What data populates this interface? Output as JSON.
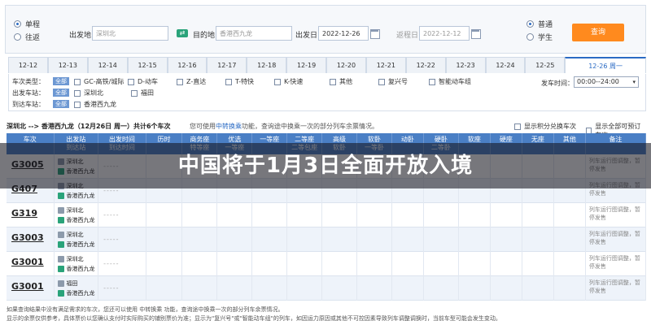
{
  "search": {
    "trip_types": [
      "单程",
      "往返"
    ],
    "from_label": "出发地",
    "from_value": "深圳北",
    "to_label": "目的地",
    "to_value": "香港西九龙",
    "depart_label": "出发日",
    "depart_value": "2022-12-26",
    "return_label": "返程日",
    "return_value": "2022-12-12",
    "passenger_types": [
      "普通",
      "学生"
    ],
    "query_button": "查询"
  },
  "date_tabs": [
    "12-12",
    "12-13",
    "12-14",
    "12-15",
    "12-16",
    "12-17",
    "12-18",
    "12-19",
    "12-20",
    "12-21",
    "12-22",
    "12-23",
    "12-24",
    "12-25",
    "12-26 周一"
  ],
  "filters": {
    "train_type_label": "车次类型：",
    "from_station_label": "出发车站：",
    "to_station_label": "到达车站：",
    "all_tag": "全部",
    "train_types": [
      "GC-高铁/城际",
      "D-动车",
      "Z-直达",
      "T-特快",
      "K-快速",
      "其他",
      "复兴号",
      "智能动车组"
    ],
    "from_stations": [
      "深圳北"
    ],
    "to_stations": [
      "香港西九龙",
      "福田"
    ],
    "depart_time_label": "发车时间：",
    "depart_time_value": "00:00--24:00"
  },
  "summary": {
    "route": "深圳北 --> 香港西九龙（12月26日 周一）共计6个车次",
    "hint_prefix": "您可使用",
    "hint_link": "中转换乘",
    "hint_suffix": "功能，查询途中换乘一次的部分列车余票情况。",
    "opt_points": "显示积分兑换车次",
    "opt_all": "显示全部可预订车次"
  },
  "table": {
    "headers": [
      "车次",
      "出发站\n到达站",
      "出发时间\n到达时间",
      "历时",
      "商务座\n特等座",
      "优选\n一等座",
      "一等座",
      "二等座\n二等包座",
      "高级\n软卧",
      "软卧\n一等卧",
      "动卧",
      "硬卧\n二等卧",
      "软座",
      "硬座",
      "无座",
      "其他",
      "备注"
    ],
    "rows": [
      {
        "train": "G3005",
        "from": "深圳北",
        "to": "香港西九龙",
        "remark": "列车运行图调整，暂停发售"
      },
      {
        "train": "G407",
        "from": "深圳北",
        "to": "香港西九龙",
        "remark": "列车运行图调整，暂停发售"
      },
      {
        "train": "G319",
        "from": "深圳北",
        "to": "香港西九龙",
        "remark": "列车运行图调整，暂停发售"
      },
      {
        "train": "G3003",
        "from": "深圳北",
        "to": "香港西九龙",
        "remark": "列车运行图调整，暂停发售"
      },
      {
        "train": "G3001",
        "from": "深圳北",
        "to": "香港西九龙",
        "remark": "列车运行图调整，暂停发售"
      },
      {
        "train": "G3001",
        "from": "福田",
        "to": "香港西九龙",
        "remark": "列车运行图调整，暂停发售"
      }
    ],
    "empty_cell": "-----"
  },
  "notes": [
    "如果查询结果中没有满足需求的车次，您还可以使用 中转换乘 功能，查询途中换乘一次的部分列车余票情况。",
    "显示的余票仅供参考，具体票价以您确认支付时实际购买的铺别票价为准；显示为\"复兴号\"或\"智能动车组\"的列车，如因运力原因或其他不可控因素导致列车调整调换时，当前车型可能会发生变动。"
  ],
  "overlay_title": "中国将于1月3日全面开放入境",
  "colors": {
    "header_blue": "#4a7fc5",
    "query_orange": "#ff8a1e",
    "badge_green": "#2aa37a",
    "badge_grey": "#8c9aab"
  }
}
